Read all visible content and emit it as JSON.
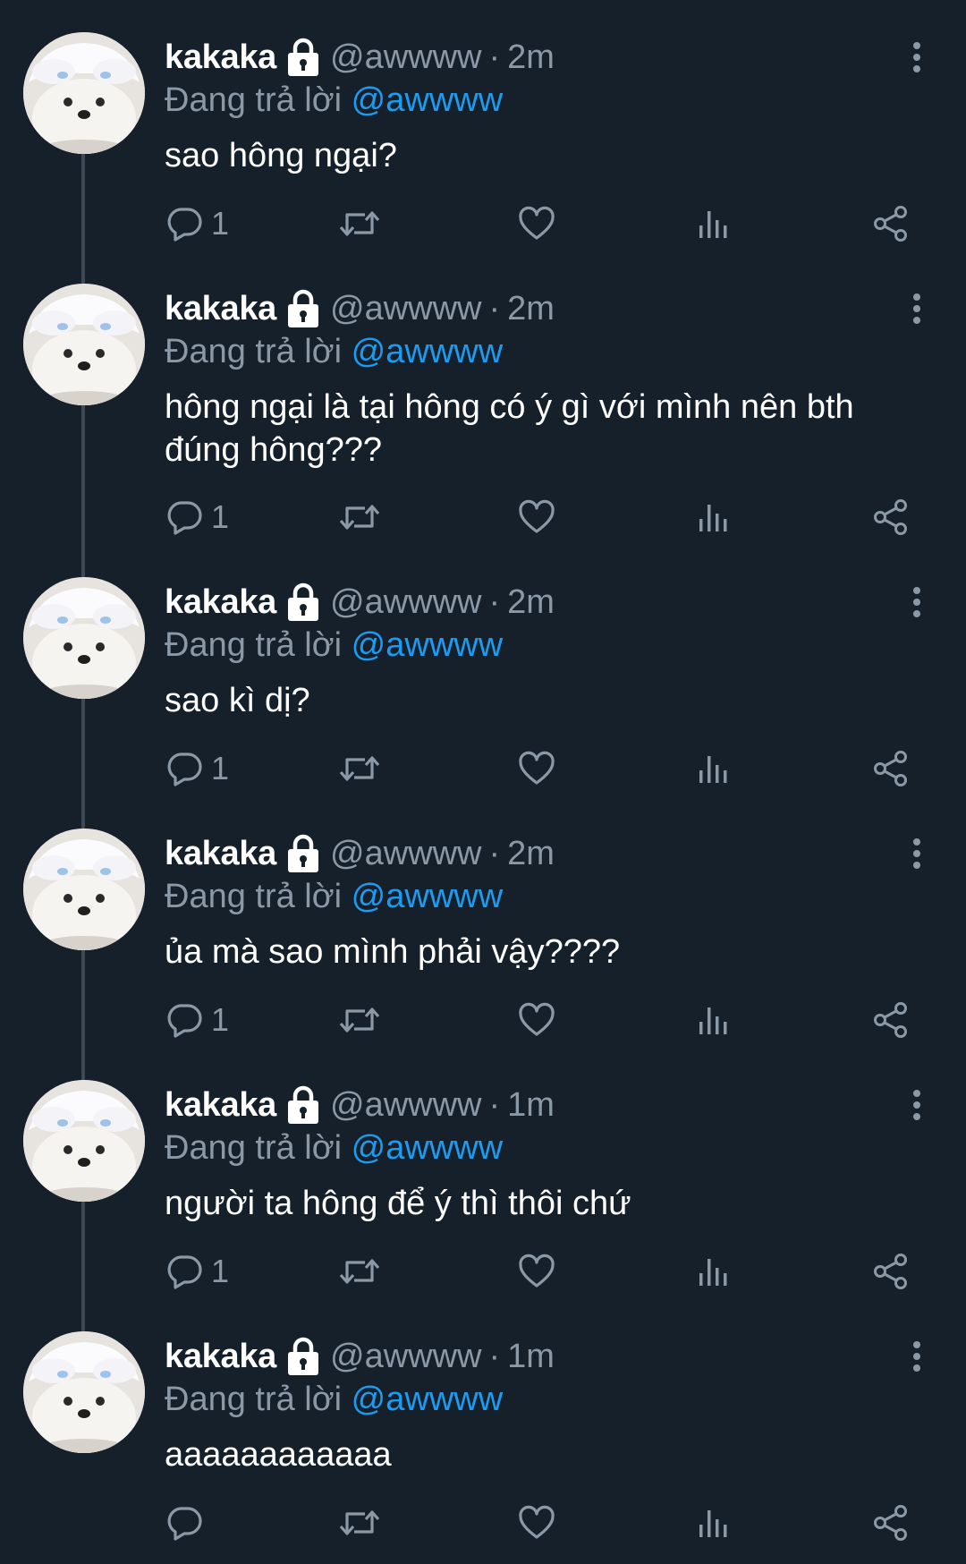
{
  "colors": {
    "background": "#15202b",
    "text_primary": "#ffffff",
    "text_secondary": "#8b98a5",
    "mention": "#1d9bf0",
    "thread_line": "#3d4954"
  },
  "icons": {
    "lock": "lock-icon",
    "more": "more-vertical-icon",
    "reply": "reply-icon",
    "retweet": "retweet-icon",
    "like": "heart-icon",
    "views": "views-icon",
    "share": "share-icon"
  },
  "tweets": [
    {
      "display_name": "kakaka",
      "handle": "@awwww",
      "separator": "·",
      "time": "2m",
      "replying_prefix": "Đang trả lời",
      "replying_to": "@awwww",
      "text": "sao hông ngại?",
      "reply_count": "1"
    },
    {
      "display_name": "kakaka",
      "handle": "@awwww",
      "separator": "·",
      "time": "2m",
      "replying_prefix": "Đang trả lời",
      "replying_to": "@awwww",
      "text": "hông ngại là tại hông có ý gì với mình nên bth đúng hông???",
      "reply_count": "1"
    },
    {
      "display_name": "kakaka",
      "handle": "@awwww",
      "separator": "·",
      "time": "2m",
      "replying_prefix": "Đang trả lời",
      "replying_to": "@awwww",
      "text": "sao kì dị?",
      "reply_count": "1"
    },
    {
      "display_name": "kakaka",
      "handle": "@awwww",
      "separator": "·",
      "time": "2m",
      "replying_prefix": "Đang trả lời",
      "replying_to": "@awwww",
      "text": "ủa mà sao mình phải vậy????",
      "reply_count": "1"
    },
    {
      "display_name": "kakaka",
      "handle": "@awwww",
      "separator": "·",
      "time": "1m",
      "replying_prefix": "Đang trả lời",
      "replying_to": "@awwww",
      "text": "người ta hông để ý thì thôi chứ",
      "reply_count": "1"
    },
    {
      "display_name": "kakaka",
      "handle": "@awwww",
      "separator": "·",
      "time": "1m",
      "replying_prefix": "Đang trả lời",
      "replying_to": "@awwww",
      "text": "aaaaaaaaaaaa",
      "reply_count": ""
    }
  ]
}
